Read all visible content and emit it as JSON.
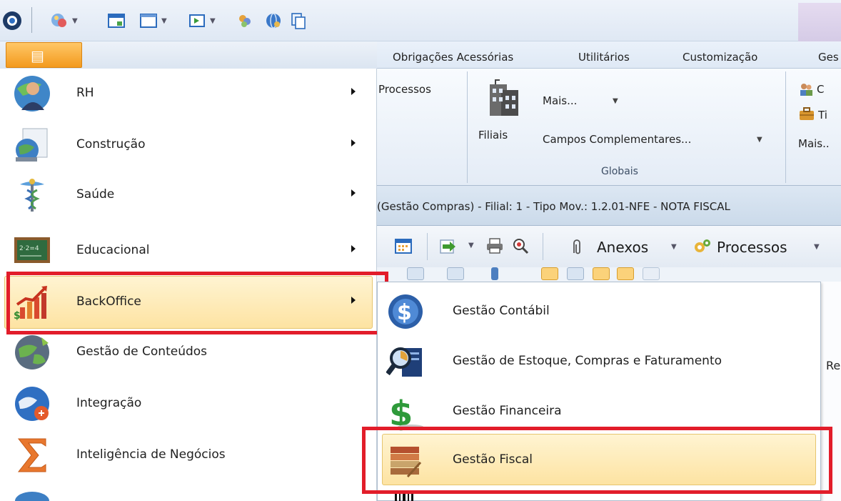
{
  "quick_access": {
    "icons": [
      "app-orb-icon",
      "globe-users-icon",
      "window-icon",
      "form-icon",
      "export-icon",
      "filter-icon",
      "web-icon",
      "copy-icon"
    ]
  },
  "ribbon": {
    "tabs": [
      "Obrigações Acessórias",
      "Utilitários",
      "Customização",
      "Ges"
    ],
    "processos_label": "Processos",
    "filiais_label": "Filiais",
    "mais_label": "Mais...",
    "campos_label": "Campos Complementares...",
    "group_label": "Globais",
    "right_items": [
      "C",
      "Ti",
      "Mais.."
    ]
  },
  "info_bar": {
    "text": "(Gestão Compras) - Filial: 1 - Tipo Mov.: 1.2.01-NFE - NOTA FISCAL"
  },
  "toolbar": {
    "anexos_label": "Anexos",
    "processos_label": "Processos"
  },
  "menu": {
    "items": [
      {
        "label": "RH",
        "icon": "rh-person-icon"
      },
      {
        "label": "Construção",
        "icon": "construction-globe-icon"
      },
      {
        "label": "Saúde",
        "icon": "caduceus-icon"
      },
      {
        "label": "Educacional",
        "icon": "chalkboard-icon"
      },
      {
        "label": "BackOffice",
        "icon": "backoffice-chart-icon"
      },
      {
        "label": "Gestão de Conteúdos",
        "icon": "content-globe-icon"
      },
      {
        "label": "Integração",
        "icon": "integration-globe-icon"
      },
      {
        "label": "Inteligência de Negócios",
        "icon": "sigma-icon"
      }
    ]
  },
  "submenu": {
    "items": [
      {
        "label": "Gestão Contábil",
        "icon": "dollar-coin-icon"
      },
      {
        "label": "Gestão de Estoque, Compras e Faturamento",
        "icon": "magnifier-chart-icon"
      },
      {
        "label": "Gestão Financeira",
        "icon": "dollar-sign-icon"
      },
      {
        "label": "Gestão Fiscal",
        "icon": "fiscal-books-icon"
      }
    ]
  },
  "grid": {
    "column_fragment": "Re"
  },
  "colors": {
    "highlight_border": "#e21d2a",
    "hover_fill": "#fde3a2",
    "app_button": "#f39a1e"
  }
}
